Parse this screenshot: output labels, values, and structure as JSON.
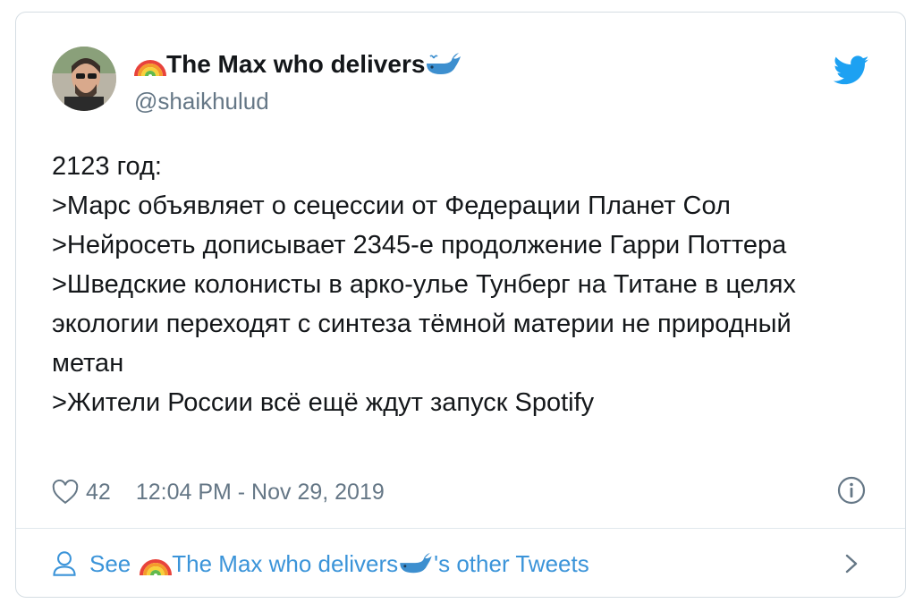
{
  "author": {
    "display_name": "The Max who delivers",
    "handle": "@shaikhulud",
    "prefix_icon": "rainbow-icon",
    "suffix_icon": "whale-icon"
  },
  "tweet": {
    "lines": [
      "2123 год:",
      ">Марс объявляет о сецессии от Федерации Планет Сол",
      ">Нейросеть дописывает 2345-е продолжение Гарри Поттера",
      ">Шведские колонисты в арко-улье Тунберг на Титане в целях экологии переходят с синтеза тёмной материи не природный метан",
      ">Жители России всё ещё ждут запуск Spotify"
    ],
    "likes": "42",
    "timestamp": "12:04 PM - Nov 29, 2019"
  },
  "footer": {
    "see_label": "See",
    "author_name": "The Max who delivers",
    "suffix_label": "'s other Tweets"
  },
  "colors": {
    "link": "#3b94d9",
    "muted": "#657786",
    "twitter_blue": "#1da1f2"
  }
}
